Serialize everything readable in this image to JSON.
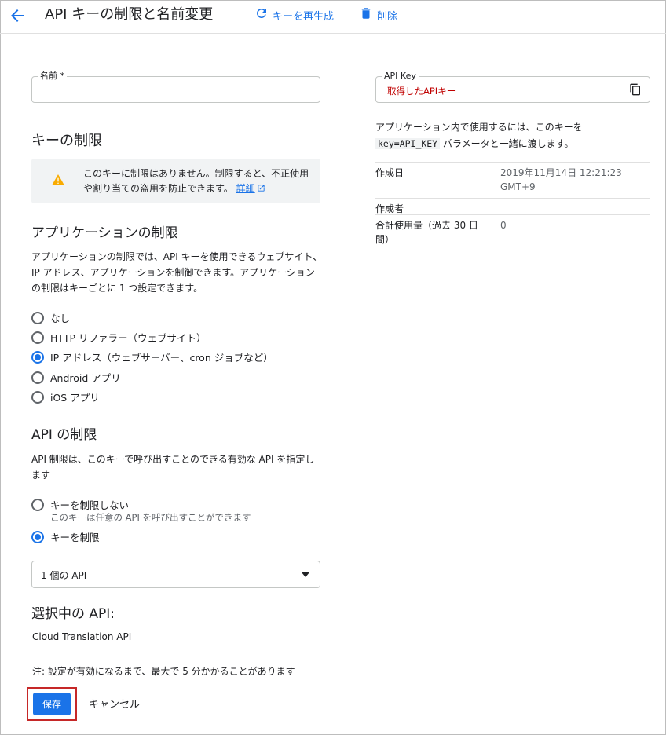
{
  "header": {
    "title": "API キーの制限と名前変更",
    "regenerate_label": "キーを再生成",
    "delete_label": "削除"
  },
  "name_field": {
    "label": "名前 *",
    "value": ""
  },
  "key_restrictions": {
    "heading": "キーの制限",
    "warning_text": "このキーに制限はありません。制限すると、不正使用や割り当ての盗用を防止できます。",
    "warning_link": "詳細"
  },
  "app_restrictions": {
    "heading": "アプリケーションの制限",
    "description": "アプリケーションの制限では、API キーを使用できるウェブサイト、IP アドレス、アプリケーションを制御できます。アプリケーションの制限はキーごとに 1 つ設定できます。",
    "options": [
      "なし",
      "HTTP リファラー（ウェブサイト）",
      "IP アドレス（ウェブサーバー、cron ジョブなど）",
      "Android アプリ",
      "iOS アプリ"
    ],
    "selected": "IP アドレス（ウェブサーバー、cron ジョブなど）"
  },
  "api_restrictions": {
    "heading": "API の制限",
    "description": "API 制限は、このキーで呼び出すことのできる有効な API を指定します",
    "option_none": "キーを制限しない",
    "option_none_sub": "このキーは任意の API を呼び出すことができます",
    "option_restrict": "キーを制限",
    "selected": "キーを制限",
    "select_value": "1 個の API"
  },
  "selected_apis": {
    "heading": "選択中の API:",
    "items": [
      "Cloud Translation API"
    ]
  },
  "note": "注: 設定が有効になるまで、最大で 5 分かかることがあります",
  "buttons": {
    "save": "保存",
    "cancel": "キャンセル"
  },
  "api_key": {
    "label": "API Key",
    "value": "取得したAPIキー",
    "usage_before": "アプリケーション内で使用するには、このキーを",
    "usage_code": "key=API_KEY",
    "usage_after": " パラメータと一緒に渡します。"
  },
  "meta": {
    "created_label": "作成日",
    "created_value": "2019年11月14日 12:21:23 GMT+9",
    "creator_label": "作成者",
    "creator_value": "",
    "usage_label": "合計使用量（過去 30 日間）",
    "usage_value": "0"
  },
  "colors": {
    "accent": "#1a73e8",
    "warning": "#f9ab00",
    "highlight_border": "#c62828",
    "key_text": "#c00000"
  }
}
